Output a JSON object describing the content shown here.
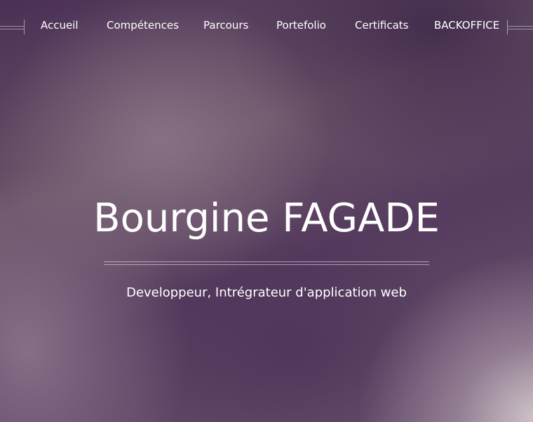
{
  "nav": {
    "items": [
      {
        "label": "Accueil"
      },
      {
        "label": "Compétences"
      },
      {
        "label": "Parcours"
      },
      {
        "label": "Portefolio"
      },
      {
        "label": "Certificats"
      },
      {
        "label": "BACKOFFICE"
      }
    ]
  },
  "hero": {
    "title": "Bourgine FAGADE",
    "subtitle": "Developpeur, Intrégrateur d'application web"
  }
}
